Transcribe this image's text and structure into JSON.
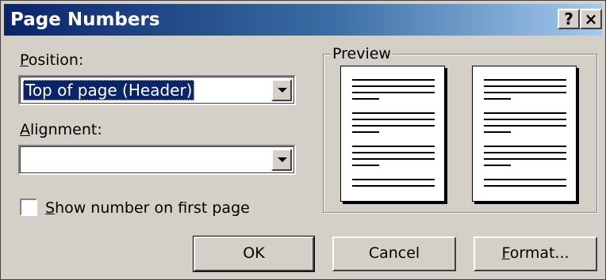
{
  "window": {
    "title": "Page Numbers",
    "help_label": "?",
    "close_label": "×"
  },
  "position": {
    "label_first": "P",
    "label_rest": "osition:",
    "value": "Top of page (Header)"
  },
  "alignment": {
    "label_first": "A",
    "label_rest": "lignment:",
    "value": ""
  },
  "show_first_page": {
    "label_first": "S",
    "label_rest": "how number on first page",
    "checked": false
  },
  "preview": {
    "title": "Preview"
  },
  "buttons": {
    "ok": "OK",
    "cancel": "Cancel",
    "format_first": "F",
    "format_rest": "ormat..."
  }
}
